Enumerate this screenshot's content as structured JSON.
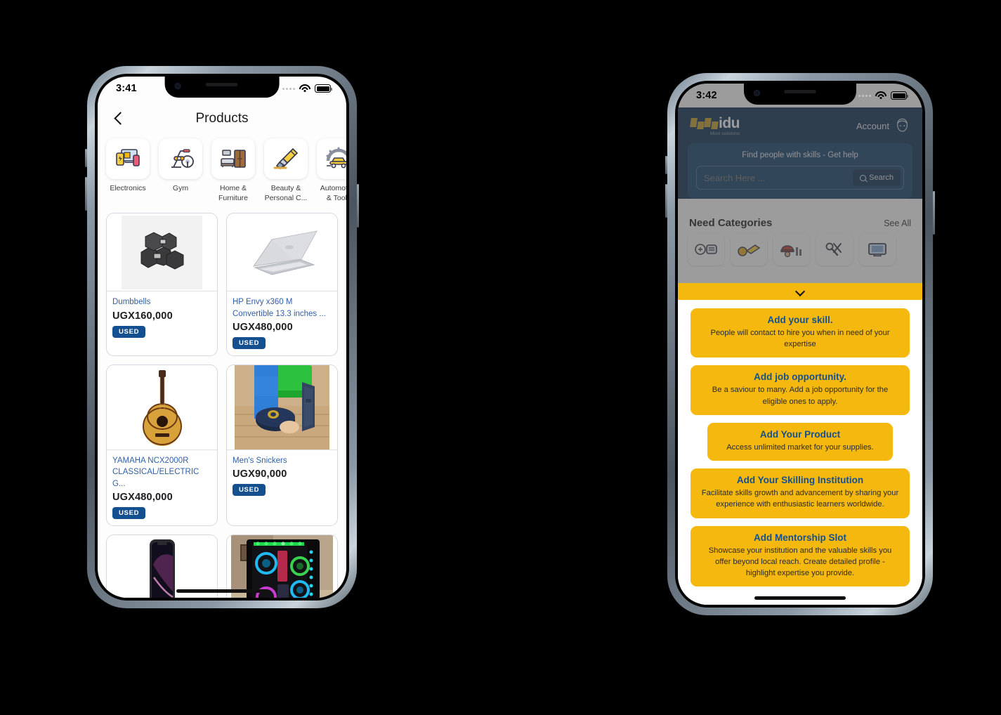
{
  "left_phone": {
    "status": {
      "time": "3:41",
      "wifi_icon": "wifi-icon",
      "battery_icon": "battery-icon"
    },
    "nav": {
      "back_icon": "chevron-left-icon",
      "title": "Products"
    },
    "categories": [
      {
        "label": "Electronics",
        "icon": "electronics-icon"
      },
      {
        "label": "Gym",
        "icon": "gym-bike-icon"
      },
      {
        "label": "Home & Furniture",
        "icon": "home-furniture-icon"
      },
      {
        "label": "Beauty & Personal C...",
        "icon": "beauty-personal-care-icon"
      },
      {
        "label": "Automotive & Tools",
        "icon": "automotive-tools-icon"
      }
    ],
    "products": [
      {
        "title": "Dumbbells",
        "price": "UGX160,000",
        "badge": "USED",
        "image": "dumbbells-photo"
      },
      {
        "title": "HP Envy x360 M Convertible 13.3 inches ...",
        "price": "UGX480,000",
        "badge": "USED",
        "image": "laptop-photo"
      },
      {
        "title": "YAMAHA NCX2000R CLASSICAL/ELECTRIC G...",
        "price": "UGX480,000",
        "badge": "USED",
        "image": "acoustic-guitar-photo"
      },
      {
        "title": "Men's Snickers",
        "price": "UGX90,000",
        "badge": "USED",
        "image": "sandals-photo"
      },
      {
        "title": "",
        "price": "",
        "badge": "",
        "image": "smartphone-photo"
      },
      {
        "title": "",
        "price": "",
        "badge": "",
        "image": "gaming-pc-photo"
      }
    ]
  },
  "right_phone": {
    "status": {
      "time": "3:42",
      "wifi_icon": "wifi-icon",
      "battery_icon": "battery-icon"
    },
    "header": {
      "logo_text": "idu",
      "logo_tagline": "More solutions",
      "account_label": "Account",
      "account_icon": "user-face-icon"
    },
    "search": {
      "prompt": "Find people with skills - Get help",
      "placeholder": "Search Here ...",
      "value": "",
      "button_label": "Search",
      "button_icon": "search-icon"
    },
    "need_categories": {
      "title": "Need Categories",
      "see_all": "See All",
      "icons": [
        "gaming-icon",
        "plumbing-icon",
        "construction-worker-icon",
        "repair-tools-icon",
        "electronics-icon"
      ]
    },
    "sheet": {
      "handle_icon": "chevron-down-icon",
      "actions": [
        {
          "title": "Add your skill.",
          "desc": "People will contact to hire you when in need of your expertise",
          "narrow": false
        },
        {
          "title": "Add job opportunity.",
          "desc": "Be a saviour to many. Add a job opportunity for the eligible ones to apply.",
          "narrow": false
        },
        {
          "title": "Add Your Product",
          "desc": "Access unlimited market for your supplies.",
          "narrow": true
        },
        {
          "title": "Add Your Skilling Institution",
          "desc": "Facilitate skills growth and advancement by sharing your experience with enthusiastic learners worldwide.",
          "narrow": false
        },
        {
          "title": "Add Mentorship Slot",
          "desc": "Showcase your institution and the valuable skills you offer beyond local reach. Create detailed profile - highlight expertise you provide.",
          "narrow": false
        }
      ]
    }
  },
  "colors": {
    "brand_navy": "#0e3055",
    "brand_yellow": "#f5b80f",
    "link_blue": "#2f5fa8",
    "badge_blue": "#14508f",
    "page_bg": "#000000"
  }
}
